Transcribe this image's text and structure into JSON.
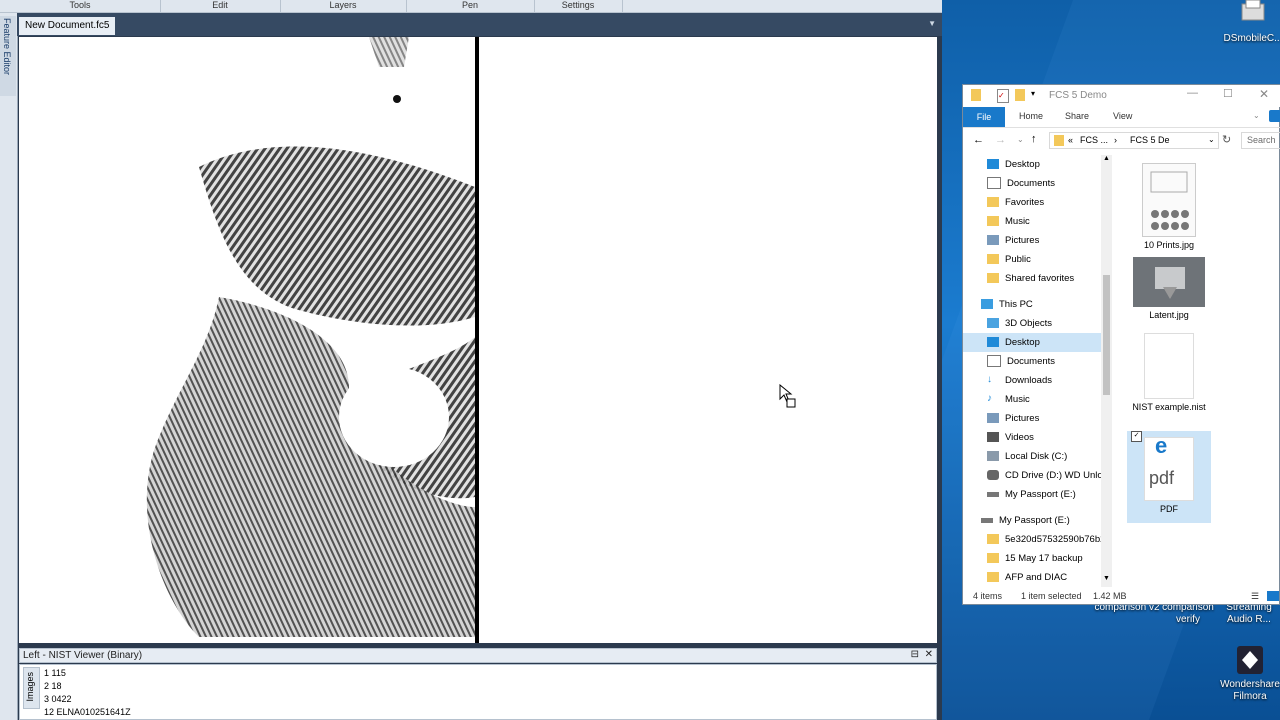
{
  "menubar": {
    "items": [
      "Tools",
      "Edit",
      "Layers",
      "Pen",
      "Settings"
    ]
  },
  "side_tab": {
    "label": "Feature Editor"
  },
  "document_tab": {
    "label": "New Document.fc5"
  },
  "bottom_panel": {
    "title": "Left - NIST Viewer (Binary)",
    "pin_icon": "pin-icon",
    "close_icon": "close-icon",
    "images_tab": "Images",
    "records": [
      "1 115",
      "2 18",
      "3 0422",
      "12 ELNA010251641Z"
    ]
  },
  "explorer": {
    "title": "FCS 5 Demo",
    "ribbon_tabs": [
      "File",
      "Home",
      "Share",
      "View"
    ],
    "address": {
      "segments": [
        "FCS ...",
        "FCS 5 De"
      ]
    },
    "search_placeholder": "Search",
    "nav_items": [
      {
        "label": "Desktop",
        "icon": "desktop-icon"
      },
      {
        "label": "Documents",
        "icon": "documents-icon"
      },
      {
        "label": "Favorites",
        "icon": "folder-icon"
      },
      {
        "label": "Music",
        "icon": "folder-icon"
      },
      {
        "label": "Pictures",
        "icon": "pictures-icon"
      },
      {
        "label": "Public",
        "icon": "folder-icon"
      },
      {
        "label": "Shared favorites",
        "icon": "folder-icon"
      },
      {
        "label": "This PC",
        "icon": "pc-icon"
      },
      {
        "label": "3D Objects",
        "icon": "3d-objects-icon"
      },
      {
        "label": "Desktop",
        "icon": "desktop-icon",
        "selected": true
      },
      {
        "label": "Documents",
        "icon": "documents-icon"
      },
      {
        "label": "Downloads",
        "icon": "downloads-icon"
      },
      {
        "label": "Music",
        "icon": "music-icon"
      },
      {
        "label": "Pictures",
        "icon": "pictures-icon"
      },
      {
        "label": "Videos",
        "icon": "videos-icon"
      },
      {
        "label": "Local Disk (C:)",
        "icon": "disk-icon"
      },
      {
        "label": "CD Drive (D:) WD Unlo",
        "icon": "cd-drive-icon"
      },
      {
        "label": "My Passport (E:)",
        "icon": "drive-icon"
      },
      {
        "label": "My Passport (E:)",
        "icon": "drive-icon"
      },
      {
        "label": "5e320d57532590b76b2",
        "icon": "folder-icon"
      },
      {
        "label": "15 May 17 backup",
        "icon": "folder-icon"
      },
      {
        "label": "AFP and DIAC",
        "icon": "folder-icon"
      }
    ],
    "files": [
      {
        "label": "10 Prints.jpg",
        "icon": "image-thumbnail-icon"
      },
      {
        "label": "Latent.jpg",
        "icon": "image-thumbnail-icon"
      },
      {
        "label": "NIST example.nist",
        "icon": "blank-file-icon"
      },
      {
        "label": "PDF",
        "icon": "edge-pdf-icon",
        "selected": true
      }
    ],
    "status": {
      "count": "4 items",
      "selection": "1 item selected",
      "size": "1.42 MB"
    }
  },
  "desktop_icons": [
    {
      "label": "DSmobileC..."
    },
    {
      "label": "comparison v2"
    },
    {
      "label": "comparison verify"
    },
    {
      "label": "Streaming Audio R..."
    },
    {
      "label": "Wondershare Filmora"
    }
  ],
  "colors": {
    "accent": "#1979ca",
    "app_bg": "#2b3a4e",
    "desktop": "#1b7cd0"
  }
}
